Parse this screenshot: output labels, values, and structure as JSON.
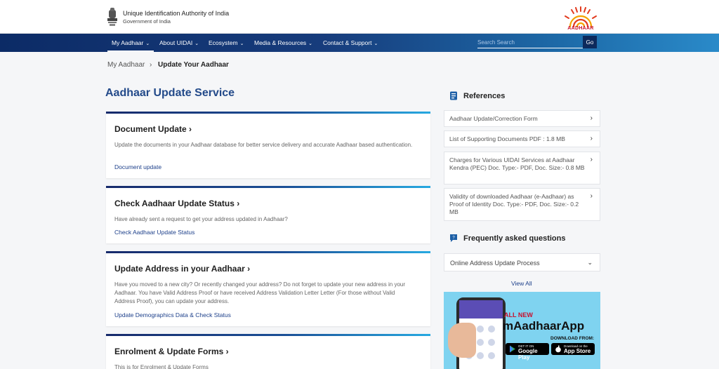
{
  "header": {
    "org_title": "Unique Identification Authority of India",
    "org_subtitle": "Government of India",
    "logo_text": "AADHAAR"
  },
  "nav": {
    "items": [
      {
        "label": "My Aadhaar"
      },
      {
        "label": "About UIDAI"
      },
      {
        "label": "Ecosystem"
      },
      {
        "label": "Media & Resources"
      },
      {
        "label": "Contact & Support"
      }
    ],
    "search_placeholder": "Search Search",
    "go_label": "Go"
  },
  "breadcrumb": {
    "home": "My Aadhaar",
    "separator": "›",
    "current": "Update Your Aadhaar"
  },
  "main": {
    "title": "Aadhaar Update Service",
    "cards": [
      {
        "title": "Document Update ›",
        "description": "Update the documents in your Aadhaar database for better service delivery and accurate Aadhaar based authentication.",
        "link": "Document update"
      },
      {
        "title": "Check Aadhaar Update Status ›",
        "description": "Have already sent a request to get your address updated in Aadhaar?",
        "link": "Check Aadhaar Update Status"
      },
      {
        "title": "Update Address in your Aadhaar ›",
        "description": "Have you moved to a new city? Or recently changed your address? Do not forget to update your new address in your Aadhaar. You have Valid Address Proof or have received Address Validation Letter Letter (For those without Valid Address Proof), you can update your address.",
        "link": "Update Demographics Data & Check Status"
      },
      {
        "title": "Enrolment & Update Forms ›",
        "description": "This is for Enrolment & Update Forms"
      }
    ]
  },
  "references": {
    "heading": "References",
    "items": [
      {
        "label": "Aadhaar Update/Correction Form"
      },
      {
        "label": "List of Supporting Documents PDF : 1.8 MB"
      },
      {
        "label": "Charges for Various UIDAI Services at Aadhaar Kendra (PEC) Doc. Type:- PDF, Doc. Size:- 0.8 MB"
      },
      {
        "label": "Validity of downloaded Aadhaar (e-Aadhaar) as Proof of Identity Doc. Type:- PDF, Doc. Size:- 0.2 MB"
      }
    ],
    "arrow": "›"
  },
  "faq": {
    "heading": "Frequently asked questions",
    "items": [
      {
        "label": "Online Address Update Process"
      }
    ],
    "view_all": "View All"
  },
  "banner": {
    "line1": "ALL NEW",
    "app_name": "mAadhaarApp",
    "download": "DOWNLOAD FROM:",
    "google_small": "GET IT ON",
    "google_big": "Google Play",
    "apple_small": "Download on the",
    "apple_big": "App Store"
  },
  "colors": {
    "nav_dark": "#0c2b66",
    "title_blue": "#234a8a",
    "link_blue": "#1c3f8a",
    "aadhaar_red": "#c8102e"
  },
  "icons": [
    "emblem-icon",
    "aadhaar-sun-logo",
    "document-icon",
    "chat-icon",
    "chevron-down-icon",
    "chevron-right-icon"
  ]
}
